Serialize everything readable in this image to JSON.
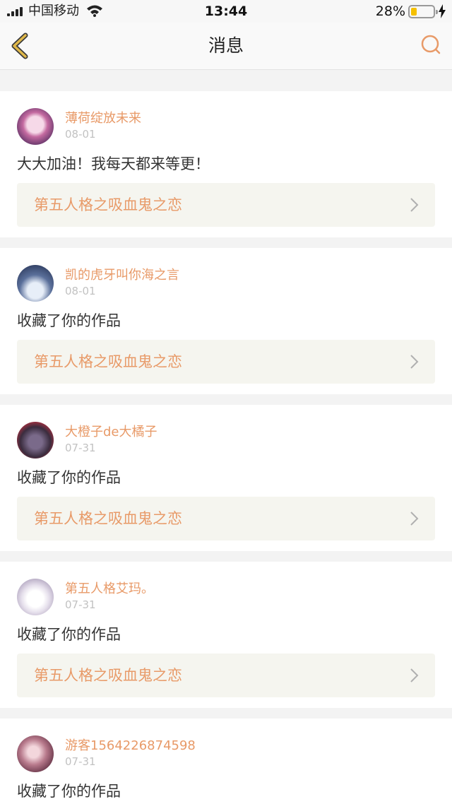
{
  "status_bar": {
    "carrier": "中国移动",
    "time": "13:44",
    "battery_percent": "28%",
    "battery_level": 0.28
  },
  "nav": {
    "title": "消息",
    "back_icon": "chevron-left-icon",
    "search_icon": "search-icon"
  },
  "colors": {
    "accent": "#e89a68",
    "back_icon": "#e0b84a",
    "work_link_bg": "#f5f5ef",
    "page_bg": "#f3f3f3"
  },
  "messages": [
    {
      "username": "薄荷绽放未来",
      "date": "08-01",
      "text": "大大加油！我每天都来等更！",
      "work_title": "第五人格之吸血鬼之恋"
    },
    {
      "username": "凯的虎牙叫你海之言",
      "date": "08-01",
      "text": "收藏了你的作品",
      "work_title": "第五人格之吸血鬼之恋"
    },
    {
      "username": "大橙子de大橘子",
      "date": "07-31",
      "text": "收藏了你的作品",
      "work_title": "第五人格之吸血鬼之恋"
    },
    {
      "username": "第五人格艾玛。",
      "date": "07-31",
      "text": "收藏了你的作品",
      "work_title": "第五人格之吸血鬼之恋"
    },
    {
      "username": "游客1564226874598",
      "date": "07-31",
      "text": "收藏了你的作品",
      "work_title": ""
    }
  ]
}
